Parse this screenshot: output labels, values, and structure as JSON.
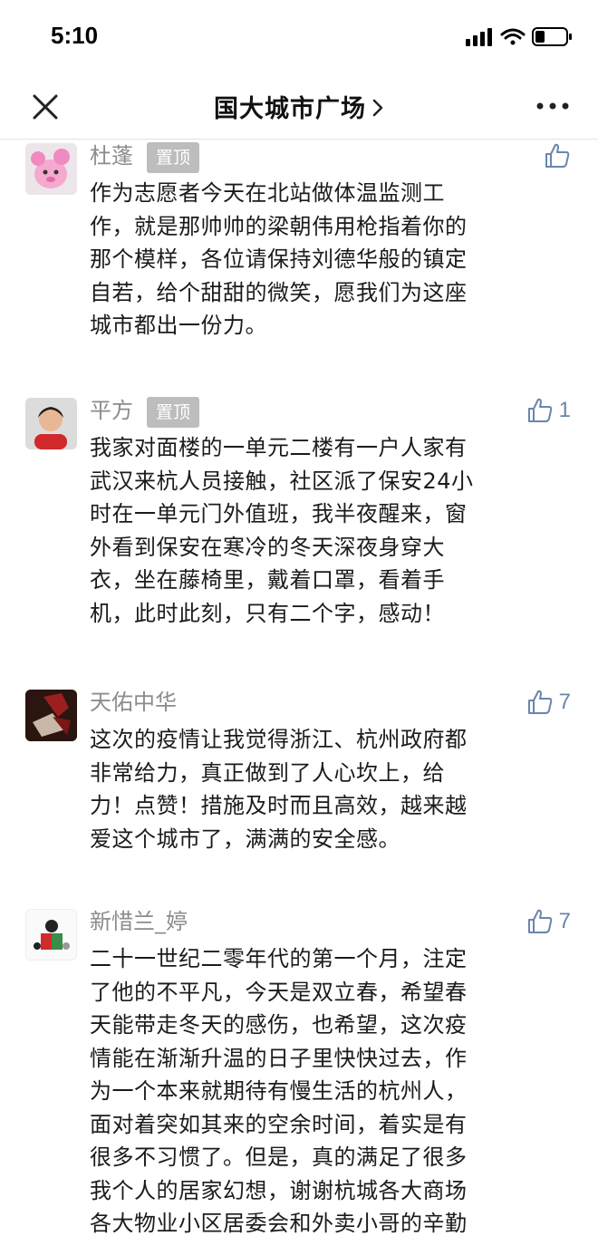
{
  "status_bar": {
    "time": "5:10",
    "signal_icon": "cellular-signal-icon",
    "wifi_icon": "wifi-icon",
    "battery_icon": "battery-low-icon"
  },
  "nav": {
    "title": "国大城市广场",
    "close_icon": "close-icon",
    "chevron_icon": "chevron-right-icon",
    "more_icon": "more-dots-icon"
  },
  "colors": {
    "accent": "#6a85ad",
    "name_gray": "#8c8c8c",
    "badge_gray": "#bdbdbd"
  },
  "comments": [
    {
      "name": "杜蓬",
      "badge": "置顶",
      "likes": "",
      "avatar": "pink-plush-toy-avatar",
      "lines": [
        "作为志愿者今天在北站做体温监测工",
        "作，就是那帅帅的梁朝伟用枪指着你的",
        "那个模样，各位请保持刘德华般的镇定",
        "自若，给个甜甜的微笑，愿我们为这座",
        "城市都出一份力。"
      ]
    },
    {
      "name": "平方",
      "badge": "置顶",
      "likes": "1",
      "avatar": "child-photo-avatar",
      "lines": [
        "我家对面楼的一单元二楼有一户人家有",
        "武汉来杭人员接触，社区派了保安24小",
        "时在一单元门外值班，我半夜醒来，窗",
        "外看到保安在寒冷的冬天深夜身穿大",
        "衣，坐在藤椅里，戴着口罩，看着手",
        "机，此时此刻，只有二个字，感动！"
      ]
    },
    {
      "name": "天佑中华",
      "badge": "",
      "likes": "7",
      "avatar": "dark-red-photo-avatar",
      "lines": [
        "这次的疫情让我觉得浙江、杭州政府都",
        "非常给力，真正做到了人心坎上，给",
        "力！点赞！措施及时而且高效，越来越",
        "爱这个城市了，满满的安全感。"
      ]
    },
    {
      "name": "新惜兰_婷",
      "badge": "",
      "likes": "7",
      "avatar": "cartoon-figure-avatar",
      "lines": [
        "二十一世纪二零年代的第一个月，注定",
        "了他的不平凡，今天是双立春，希望春",
        "天能带走冬天的感伤，也希望，这次疫",
        "情能在渐渐升温的日子里快快过去，作",
        "为一个本来就期待有慢生活的杭州人，",
        "面对着突如其来的空余时间，着实是有",
        "很多不习惯了。但是，真的满足了很多",
        "我个人的居家幻想，谢谢杭城各大商场",
        "各大物业小区居委会和外卖小哥的辛勤"
      ]
    }
  ]
}
